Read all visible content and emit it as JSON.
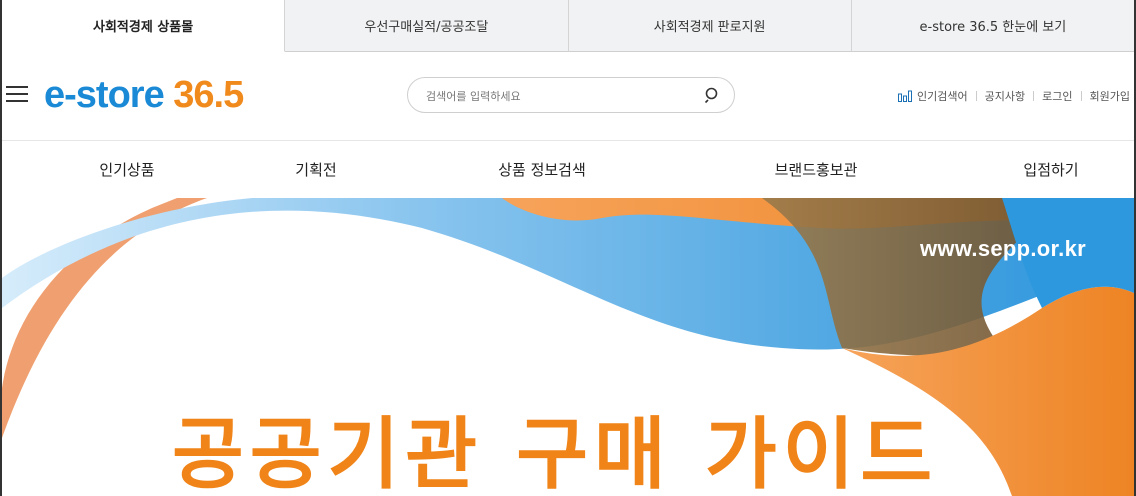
{
  "top_tabs": [
    {
      "label": "사회적경제 상품몰",
      "active": true
    },
    {
      "label": "우선구매실적/공공조달",
      "active": false
    },
    {
      "label": "사회적경제 판로지원",
      "active": false
    },
    {
      "label": "e-store 36.5 한눈에 보기",
      "active": false
    }
  ],
  "header": {
    "logo_prefix": "e-store ",
    "logo_number": "36.5",
    "search_placeholder": "검색어를 입력하세요",
    "util_links": {
      "popular": "인기검색어",
      "notice": "공지사항",
      "login": "로그인",
      "signup": "회원가입"
    }
  },
  "main_nav": [
    "인기상품",
    "기획전",
    "상품 정보검색",
    "브랜드홍보관",
    "입점하기"
  ],
  "banner": {
    "url": "www.sepp.or.kr",
    "headline": "공공기관 구매 가이드"
  },
  "colors": {
    "brand_blue": "#1a8ad6",
    "brand_orange": "#f08a1c",
    "banner_dark": "#7a5a2e"
  }
}
